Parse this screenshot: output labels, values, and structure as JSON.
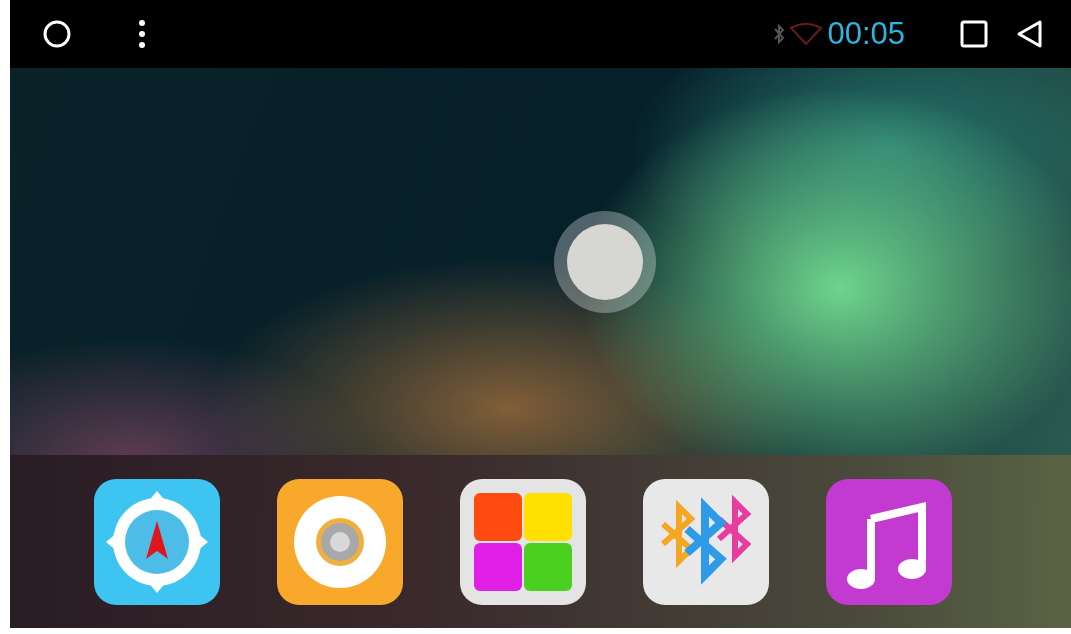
{
  "status_bar": {
    "time": "00:05"
  },
  "dock": [
    {
      "kind": "navigation"
    },
    {
      "kind": "radio"
    },
    {
      "kind": "apps"
    },
    {
      "kind": "bluetooth"
    },
    {
      "kind": "music"
    }
  ]
}
